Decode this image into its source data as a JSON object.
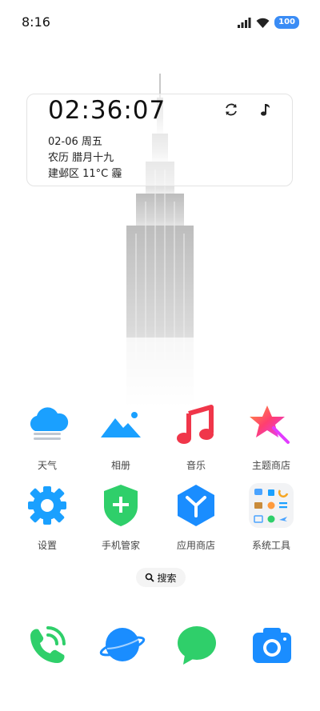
{
  "status": {
    "time": "8:16",
    "battery": "100",
    "signal_icon": "signal-icon",
    "wifi_icon": "wifi-icon"
  },
  "widget": {
    "time": "02:36:07",
    "date": "02-06 周五",
    "lunar": "农历 腊月十九",
    "weather": "建邺区 11°C 霾"
  },
  "apps_row1": [
    {
      "label": "天气",
      "icon": "weather-icon"
    },
    {
      "label": "相册",
      "icon": "gallery-icon"
    },
    {
      "label": "音乐",
      "icon": "music-icon"
    },
    {
      "label": "主题商店",
      "icon": "theme-store-icon"
    }
  ],
  "apps_row2": [
    {
      "label": "设置",
      "icon": "settings-icon"
    },
    {
      "label": "手机管家",
      "icon": "phone-manager-icon"
    },
    {
      "label": "应用商店",
      "icon": "app-store-icon"
    },
    {
      "label": "系统工具",
      "icon": "system-tools-folder-icon"
    }
  ],
  "search": {
    "label": "搜索"
  },
  "dock": [
    {
      "icon": "phone-icon"
    },
    {
      "icon": "browser-icon"
    },
    {
      "icon": "messages-icon"
    },
    {
      "icon": "camera-icon"
    }
  ],
  "colors": {
    "accent_blue": "#1aa0ff",
    "green": "#2fcf6a",
    "red": "#f0364a",
    "battery": "#3a8cf5"
  }
}
